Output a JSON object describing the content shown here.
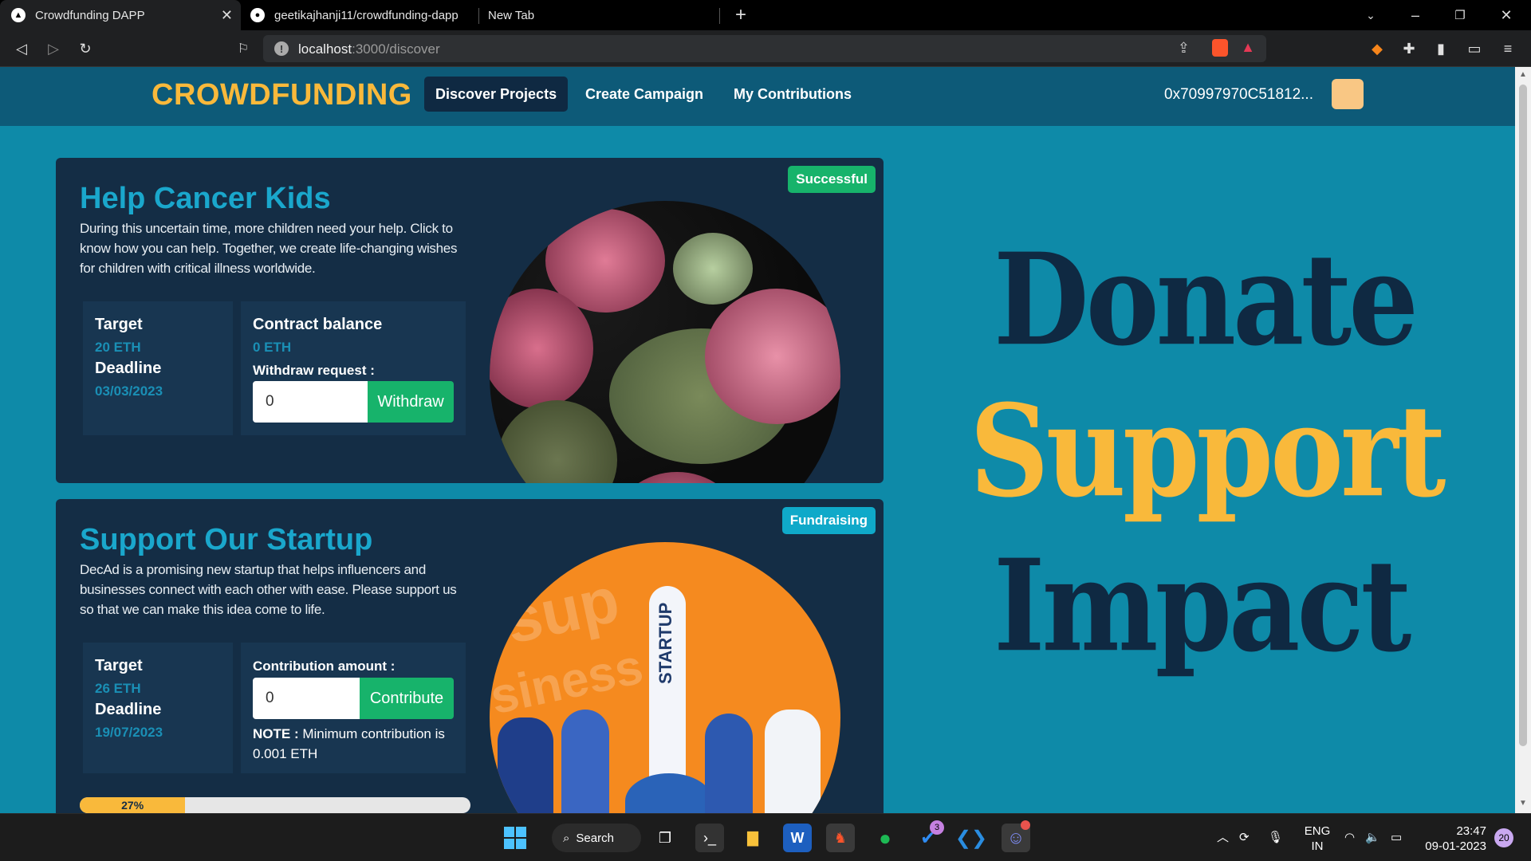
{
  "browser": {
    "tabs": [
      {
        "title": "Crowdfunding DAPP",
        "active": true
      },
      {
        "title": "geetikajhanji11/crowdfunding-dapp",
        "active": false
      },
      {
        "title": "New Tab",
        "active": false
      }
    ],
    "url_host": "localhost",
    "url_path": ":3000/discover"
  },
  "navbar": {
    "brand": "CROWDFUNDING",
    "links": [
      "Discover Projects",
      "Create Campaign",
      "My Contributions"
    ],
    "wallet_address": "0x70997970C51812..."
  },
  "projects": [
    {
      "title": "Help Cancer Kids",
      "description": "During this uncertain time, more children need your help. Click to know how you can help. Together, we create life-changing wishes for children with critical illness worldwide.",
      "status": "Successful",
      "target_label": "Target",
      "target": "20 ETH",
      "deadline_label": "Deadline",
      "deadline": "03/03/2023",
      "balance_label": "Contract balance",
      "balance": "0 ETH",
      "withdraw_label": "Withdraw request :",
      "input_value": "0",
      "action_label": "Withdraw"
    },
    {
      "title": "Support Our Startup",
      "description": "DecAd is a promising new startup that helps influencers and businesses connect with each other with ease. Please support us so that we can make this idea come to life.",
      "status": "Fundraising",
      "target_label": "Target",
      "target": "26 ETH",
      "deadline_label": "Deadline",
      "deadline": "19/07/2023",
      "contribution_label": "Contribution amount :",
      "input_value": "0",
      "action_label": "Contribute",
      "note_bold": "NOTE :",
      "note_text": " Minimum contribution is 0.001 ETH",
      "progress": 0.27,
      "progress_label": "27%",
      "rocket_text": "STARTUP"
    }
  ],
  "hero": {
    "words": [
      "Donate",
      "Support",
      "Impact"
    ]
  },
  "taskbar": {
    "search_label": "Search",
    "lang_top": "ENG",
    "lang_bottom": "IN",
    "time": "23:47",
    "date": "09-01-2023",
    "todo_badge": "3",
    "notif_count": "20"
  },
  "colors": {
    "accent_yellow": "#f9b93b",
    "page_bg": "#0e8aa8",
    "card_bg": "#142d45",
    "success_green": "#17b36b",
    "fundraising_cyan": "#0fa9c9"
  }
}
